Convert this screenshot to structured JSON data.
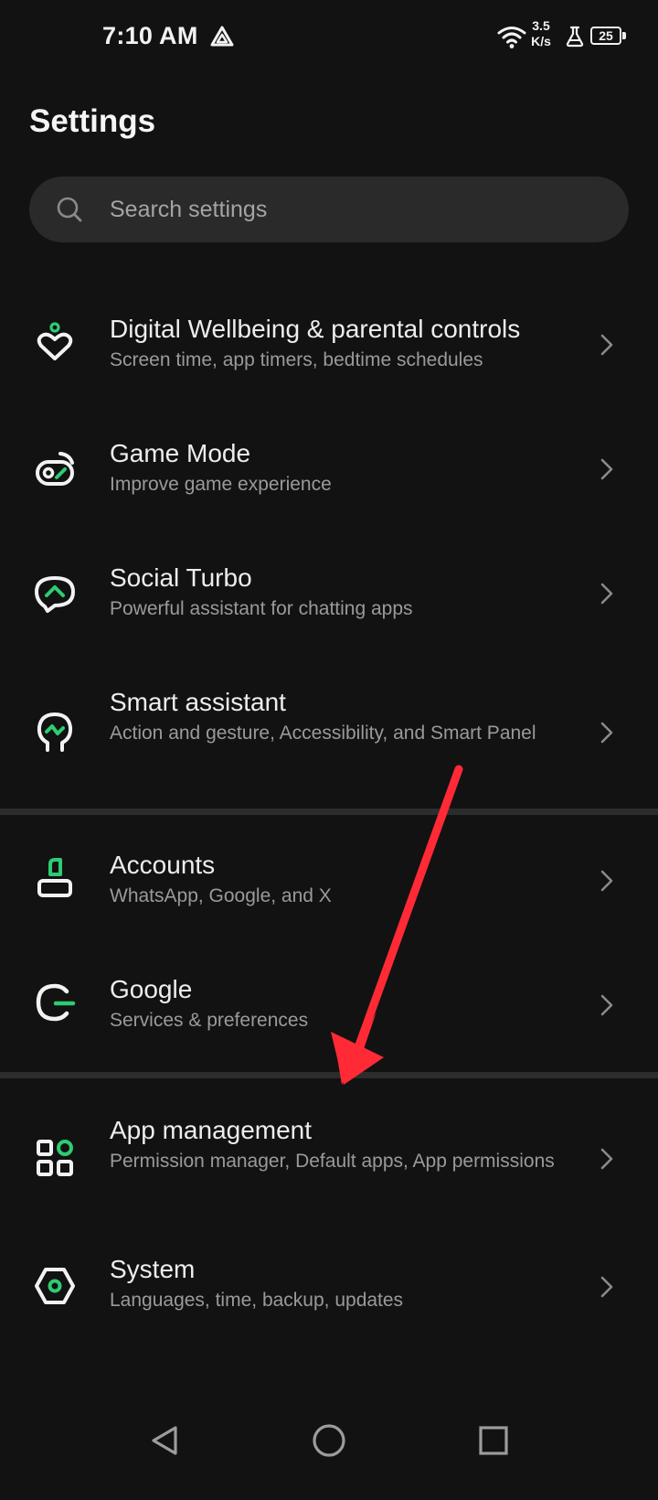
{
  "status_bar": {
    "time": "7:10 AM",
    "net_speed_value": "3.5",
    "net_speed_unit": "K/s",
    "battery_level": "25",
    "icons": [
      "drive-icon",
      "wifi-icon",
      "lab-flask-icon",
      "battery-icon"
    ]
  },
  "header": {
    "title": "Settings"
  },
  "search": {
    "placeholder": "Search settings",
    "value": ""
  },
  "settings_items": [
    {
      "title": "Digital Wellbeing & parental controls",
      "subtitle": "Screen time, app timers, bedtime schedules",
      "icon": "digital-wellbeing-icon"
    },
    {
      "title": "Game Mode",
      "subtitle": "Improve game experience",
      "icon": "game-mode-icon"
    },
    {
      "title": "Social Turbo",
      "subtitle": "Powerful assistant for chatting apps",
      "icon": "social-turbo-icon"
    },
    {
      "title": "Smart assistant",
      "subtitle": "Action and gesture, Accessibility, and Smart Panel",
      "icon": "smart-assistant-icon"
    },
    {
      "title": "Accounts",
      "subtitle": "WhatsApp, Google, and X",
      "icon": "accounts-icon"
    },
    {
      "title": "Google",
      "subtitle": "Services & preferences",
      "icon": "google-icon"
    },
    {
      "title": "App management",
      "subtitle": "Permission manager, Default apps, App permissions",
      "icon": "app-management-icon"
    },
    {
      "title": "System",
      "subtitle": "Languages, time, backup, updates",
      "icon": "system-icon"
    }
  ],
  "nav_bar": {
    "buttons": [
      "back-icon",
      "home-icon",
      "recents-icon"
    ]
  },
  "colors": {
    "background": "#121212",
    "accent_green": "#2ecc71",
    "icon_white": "#f2f2f2",
    "search_bg": "#2a2a2a",
    "subtitle_gray": "#9a9a9a",
    "divider": "#2c2c2c",
    "annotation_red": "#ff2a35"
  }
}
